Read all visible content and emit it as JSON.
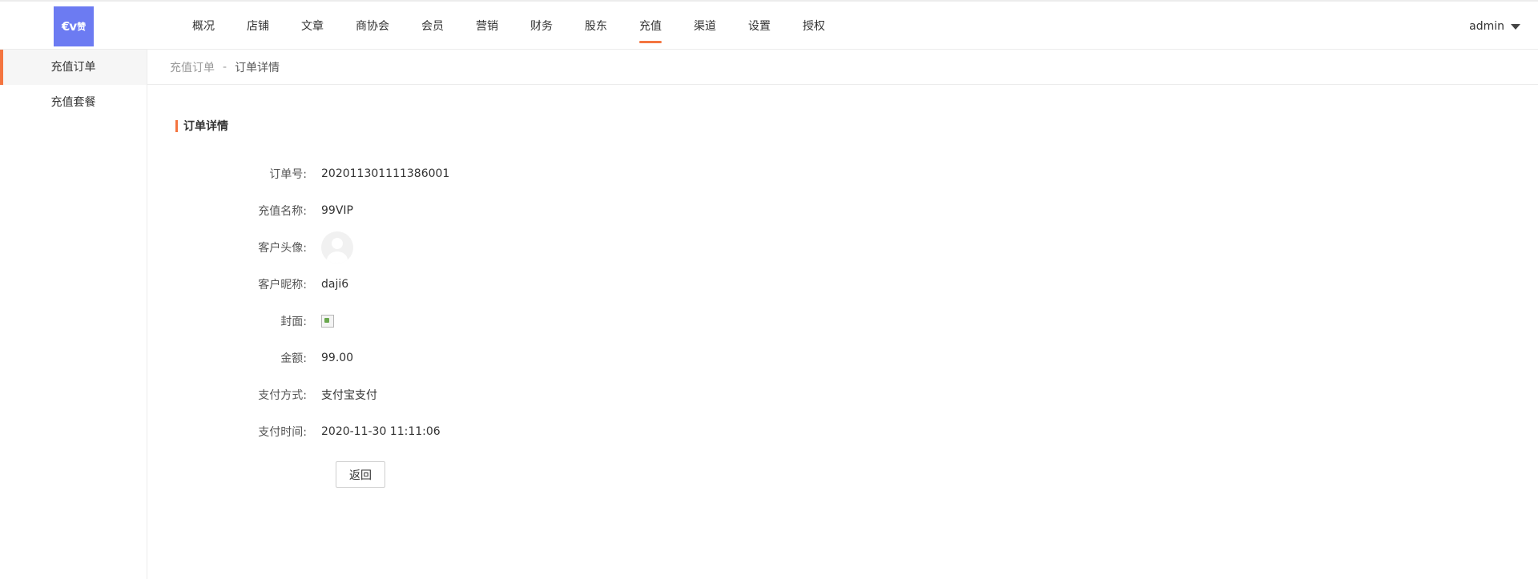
{
  "header": {
    "logo_mark": "€v",
    "logo_text": "赞",
    "nav": [
      {
        "label": "概况"
      },
      {
        "label": "店铺"
      },
      {
        "label": "文章"
      },
      {
        "label": "商协会"
      },
      {
        "label": "会员"
      },
      {
        "label": "营销"
      },
      {
        "label": "财务"
      },
      {
        "label": "股东"
      },
      {
        "label": "充值",
        "active": true
      },
      {
        "label": "渠道"
      },
      {
        "label": "设置"
      },
      {
        "label": "授权"
      }
    ],
    "user": "admin",
    "user_icon": "caret-down-icon"
  },
  "sidebar": {
    "items": [
      {
        "label": "充值订单",
        "active": true
      },
      {
        "label": "充值套餐"
      }
    ]
  },
  "breadcrumb": {
    "parent": "充值订单",
    "separator": "-",
    "current": "订单详情"
  },
  "detail": {
    "title": "订单详情",
    "fields": {
      "order_no": {
        "label": "订单号:",
        "value": "202011301111386001"
      },
      "package_name": {
        "label": "充值名称:",
        "value": "99VIP"
      },
      "avatar": {
        "label": "客户头像:",
        "icon": "avatar-placeholder-icon"
      },
      "nickname": {
        "label": "客户昵称:",
        "value": "daji6"
      },
      "cover": {
        "label": "封面:",
        "icon": "broken-image-icon"
      },
      "amount": {
        "label": "金额:",
        "value": "99.00"
      },
      "pay_method": {
        "label": "支付方式:",
        "value": "支付宝支付"
      },
      "pay_time": {
        "label": "支付时间:",
        "value": "2020-11-30 11:11:06"
      }
    },
    "back_label": "返回"
  },
  "colors": {
    "accent": "#f47540",
    "logo_bg": "#6c7bf2",
    "border": "#ececec"
  }
}
